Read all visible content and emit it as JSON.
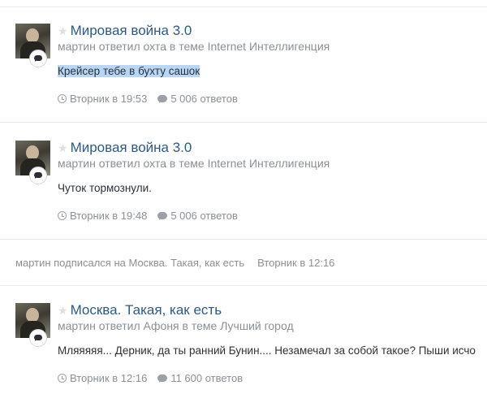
{
  "posts": [
    {
      "title": "Мировая война 3.0",
      "meta": "мартин ответил охта в теме Internet Интеллигенция",
      "body": "Крейсер тебе в бухту сашок",
      "time": "Вторник в 19:53",
      "replies": "5 006 ответов"
    },
    {
      "title": "Мировая война 3.0",
      "meta": "мартин ответил охта в теме Internet Интеллигенция",
      "body": "Чуток тормознули.",
      "time": "Вторник в 19:48",
      "replies": "5 006 ответов"
    },
    {
      "title": "Москва. Такая, как есть",
      "meta": "мартин ответил Афоня в теме Лучший город",
      "body": "Мляяяяя... Дерник, да ты ранний Бунин.... Незамечал за собой такое? Пыши исчо",
      "time": "Вторник в 12:16",
      "replies": "11 600 ответов"
    }
  ],
  "activity": {
    "text": "мартин подписался на Москва. Такая, как есть",
    "time": "Вторник в 12:16"
  },
  "icons": {
    "star": "star-icon",
    "badge": "comment-bubble-icon",
    "time": "clock-icon",
    "replies": "comment-icon"
  },
  "colors": {
    "title": "#2a5b88",
    "meta": "#8a9096",
    "highlight": "#b8d7f7"
  }
}
